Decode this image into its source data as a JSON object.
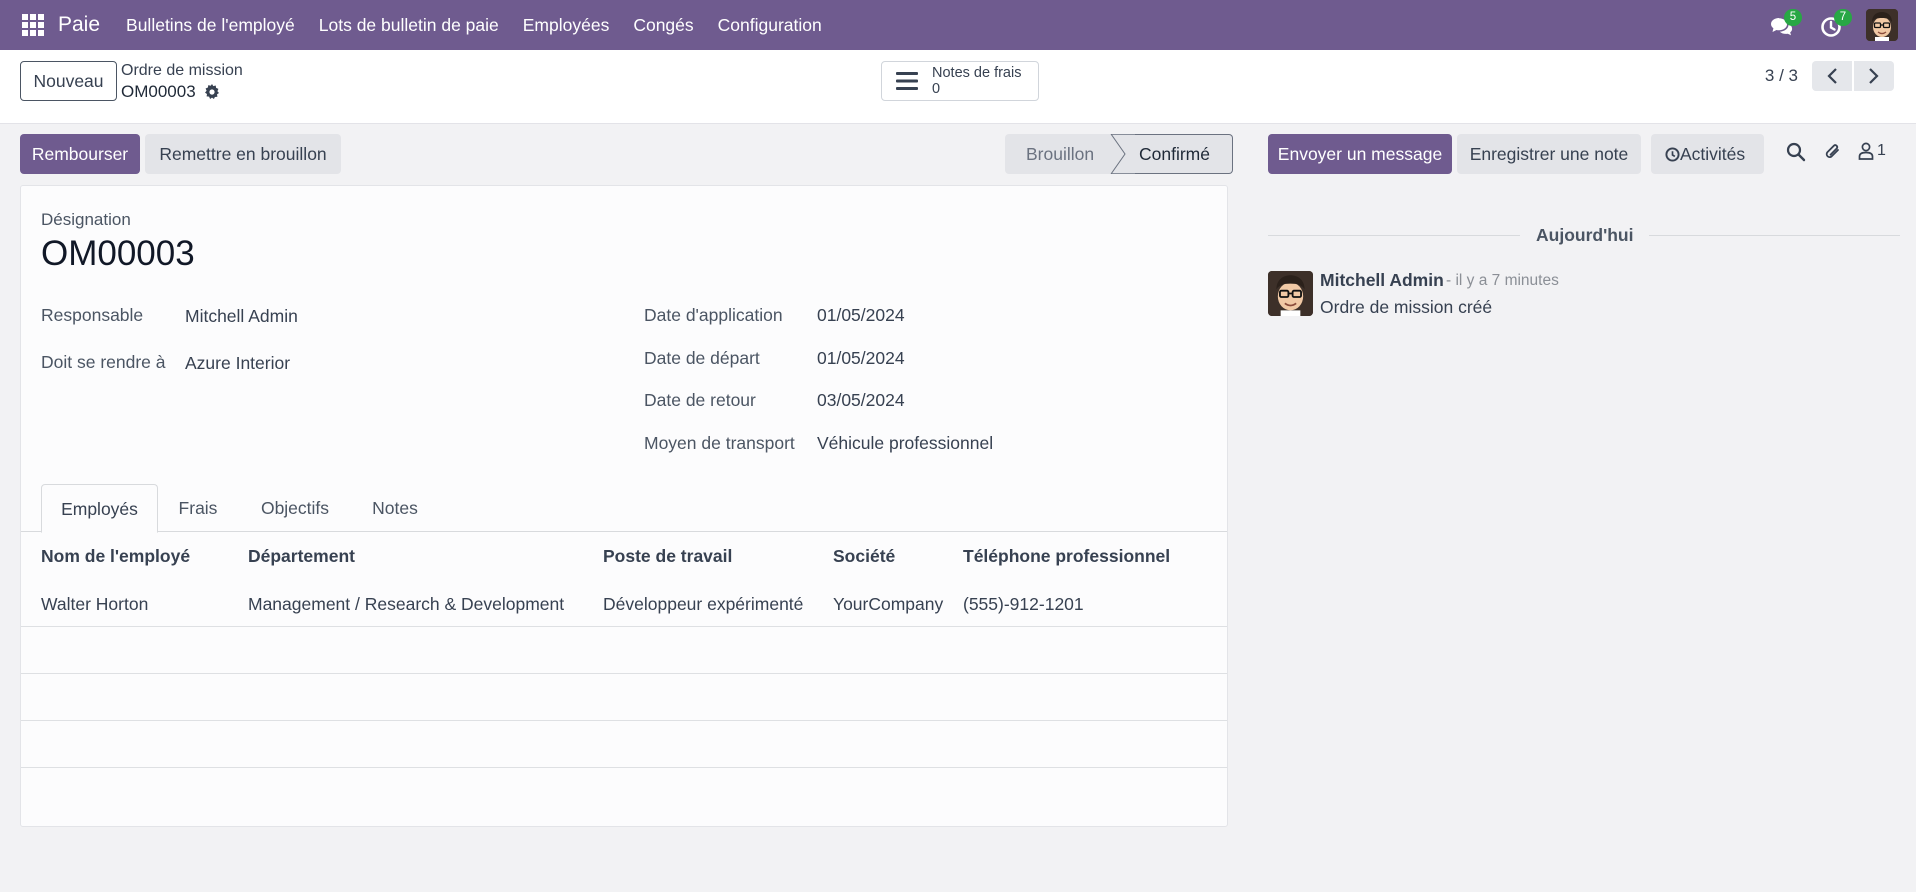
{
  "navbar": {
    "app_name": "Paie",
    "menu": [
      "Bulletins de l'employé",
      "Lots de bulletin de paie",
      "Employées",
      "Congés",
      "Configuration"
    ],
    "messages_count": "5",
    "activities_count": "7",
    "brand_color": "#6f5b8f"
  },
  "control_panel": {
    "new_label": "Nouveau",
    "breadcrumb": "Ordre de mission",
    "record_name": "OM00003",
    "smart_button": {
      "label": "Notes de frais",
      "count": "0"
    },
    "pager": "3 / 3"
  },
  "statusbar": {
    "reimburse_label": "Rembourser",
    "reset_label": "Remettre en brouillon",
    "stages": [
      "Brouillon",
      "Confirmé"
    ],
    "current_stage": "Confirmé"
  },
  "form": {
    "designation_label": "Désignation",
    "designation": "OM00003",
    "left_fields": [
      {
        "label": "Responsable",
        "value": "Mitchell Admin"
      },
      {
        "label": "Doit se rendre à",
        "value": "Azure Interior"
      }
    ],
    "right_fields": [
      {
        "label": "Date d'application",
        "value": "01/05/2024"
      },
      {
        "label": "Date de départ",
        "value": "01/05/2024"
      },
      {
        "label": "Date de retour",
        "value": "03/05/2024"
      },
      {
        "label": "Moyen de transport",
        "value": "Véhicule professionnel"
      }
    ],
    "tabs": [
      "Employés",
      "Frais",
      "Objectifs",
      "Notes"
    ],
    "active_tab": "Employés",
    "table": {
      "columns": [
        "Nom de l'employé",
        "Département",
        "Poste de travail",
        "Société",
        "Téléphone professionnel"
      ],
      "rows": [
        [
          "Walter Horton",
          "Management / Research & Development",
          "Développeur expérimenté",
          "YourCompany",
          "(555)-912-1201"
        ]
      ]
    }
  },
  "chatter": {
    "send_message_label": "Envoyer un message",
    "log_note_label": "Enregistrer une note",
    "activities_label": "Activités",
    "followers_count": "1",
    "date_separator": "Aujourd'hui",
    "message": {
      "author": "Mitchell Admin",
      "time": "- il y a 7 minutes",
      "body": "Ordre de mission créé"
    }
  }
}
